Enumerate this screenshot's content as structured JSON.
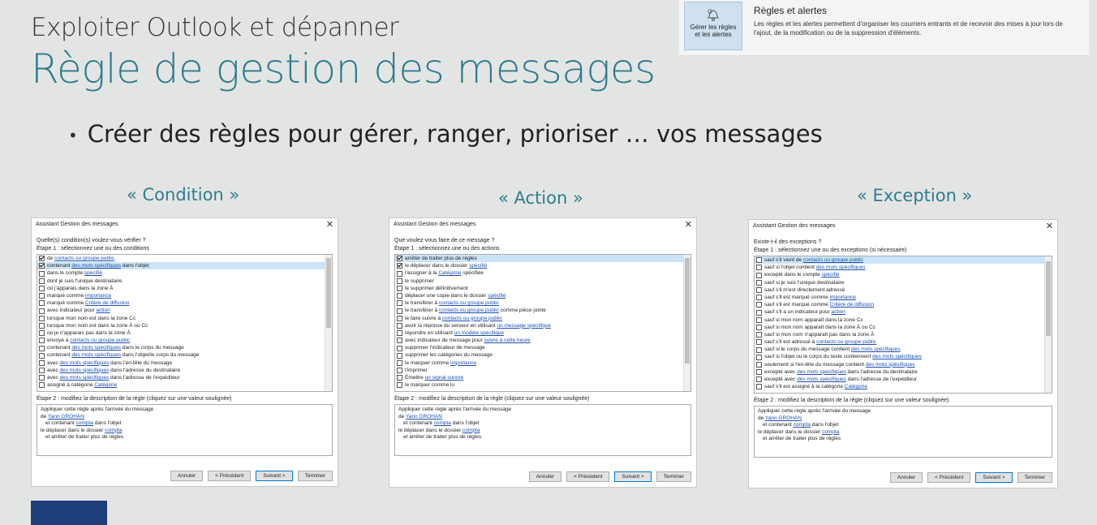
{
  "header": {
    "subtitle": "Exploiter Outlook et dépanner",
    "title": "Règle de gestion des messages",
    "bullet": "Créer des règles pour gérer, ranger, prioriser … vos messages"
  },
  "rules_panel": {
    "button_line1": "Gérer les règles",
    "button_line2": "et les alertes",
    "heading": "Règles et alertes",
    "description": "Les règles et les alertes permettent d'organiser les courriers entrants et de recevoir des mises à jour lors de l'ajout, de la modification ou de la suppression d'éléments."
  },
  "sections": {
    "condition": "« Condition »",
    "action": "« Action »",
    "exception": "« Exception »"
  },
  "dialog_common": {
    "title": "Assistant Gestion des messages",
    "close": "✕",
    "step2": "Étape 2 : modifiez la description de la règle (cliquez sur une valeur soulignée)",
    "buttons": {
      "cancel": "Annuler",
      "prev": "< Précédent",
      "next": "Suivant >",
      "finish": "Terminer"
    }
  },
  "dialogs": [
    {
      "question": "Quelle(s) condition(s) voulez-vous vérifier ?",
      "step1": "Étape 1 : sélectionnez une ou des conditions",
      "items": [
        {
          "checked": true,
          "pre": "de ",
          "link": "contacts ou groupe public",
          "post": ""
        },
        {
          "checked": true,
          "pre": "contenant ",
          "link": "des mots spécifiques",
          "post": " dans l'objet",
          "selected": true
        },
        {
          "checked": false,
          "pre": "dans le compte ",
          "link": "spécifié",
          "post": ""
        },
        {
          "checked": false,
          "pre": "dont je suis l'unique destinataire",
          "link": "",
          "post": ""
        },
        {
          "checked": false,
          "pre": "où j'apparais dans la zone À",
          "link": "",
          "post": ""
        },
        {
          "checked": false,
          "pre": "marqué comme ",
          "link": "importance",
          "post": ""
        },
        {
          "checked": false,
          "pre": "marqué comme ",
          "link": "Critère de diffusion",
          "post": ""
        },
        {
          "checked": false,
          "pre": "avec indicateur pour ",
          "link": "action",
          "post": ""
        },
        {
          "checked": false,
          "pre": "lorsque mon nom est dans la zone Cc",
          "link": "",
          "post": ""
        },
        {
          "checked": false,
          "pre": "lorsque mon nom est dans la zone À ou Cc",
          "link": "",
          "post": ""
        },
        {
          "checked": false,
          "pre": "où je n'apparais pas dans la zone À",
          "link": "",
          "post": ""
        },
        {
          "checked": false,
          "pre": "envoyé à ",
          "link": "contacts ou groupe public",
          "post": ""
        },
        {
          "checked": false,
          "pre": "contenant ",
          "link": "des mots spécifiques",
          "post": " dans le corps du message"
        },
        {
          "checked": false,
          "pre": "contenant ",
          "link": "des mots spécifiques",
          "post": " dans l'objet/le corps du message"
        },
        {
          "checked": false,
          "pre": "avec ",
          "link": "des mots spécifiques",
          "post": " dans l'en-tête du message"
        },
        {
          "checked": false,
          "pre": "avec ",
          "link": "des mots spécifiques",
          "post": " dans l'adresse du destinataire"
        },
        {
          "checked": false,
          "pre": "avec ",
          "link": "des mots spécifiques",
          "post": " dans l'adresse de l'expéditeur"
        },
        {
          "checked": false,
          "pre": "assigné à catégorie ",
          "link": "Catégorie",
          "post": ""
        }
      ]
    },
    {
      "question": "Que voulez-vous faire de ce message ?",
      "step1": "Étape 1 : sélectionnez une ou des actions",
      "items": [
        {
          "checked": true,
          "pre": "arrêter de traiter plus de règles",
          "link": "",
          "post": "",
          "selected": true
        },
        {
          "checked": true,
          "pre": "le déplacer dans le dossier ",
          "link": "spécifié",
          "post": ""
        },
        {
          "checked": false,
          "pre": "l'assigner à la ",
          "link": "Catégorie",
          "post": " spécifiée"
        },
        {
          "checked": false,
          "pre": "le supprimer",
          "link": "",
          "post": ""
        },
        {
          "checked": false,
          "pre": "le supprimer définitivement",
          "link": "",
          "post": ""
        },
        {
          "checked": false,
          "pre": "déplacer une copie dans le dossier ",
          "link": "spécifié",
          "post": ""
        },
        {
          "checked": false,
          "pre": "le transférer à ",
          "link": "contacts ou groupe public",
          "post": ""
        },
        {
          "checked": false,
          "pre": "le transférer à ",
          "link": "contacts ou groupe public",
          "post": " comme pièce jointe"
        },
        {
          "checked": false,
          "pre": "le faire suivre à ",
          "link": "contacts ou groupe public",
          "post": ""
        },
        {
          "checked": false,
          "pre": "avoir la réponse du serveur en utilisant ",
          "link": "un message spécifique",
          "post": ""
        },
        {
          "checked": false,
          "pre": "répondre en utilisant ",
          "link": "un modèle spécifique",
          "post": ""
        },
        {
          "checked": false,
          "pre": "avec indicateur de message pour ",
          "link": "suivre à cette heure",
          "post": ""
        },
        {
          "checked": false,
          "pre": "supprimer l'indicateur de message",
          "link": "",
          "post": ""
        },
        {
          "checked": false,
          "pre": "supprimer les catégories du message",
          "link": "",
          "post": ""
        },
        {
          "checked": false,
          "pre": "le marquer comme ",
          "link": "importance",
          "post": ""
        },
        {
          "checked": false,
          "pre": "l'imprimer",
          "link": "",
          "post": ""
        },
        {
          "checked": false,
          "pre": "Émettre ",
          "link": "un signal sonore",
          "post": ""
        },
        {
          "checked": false,
          "pre": "le marquer comme lu",
          "link": "",
          "post": ""
        }
      ]
    },
    {
      "question": "Existe-t-il des exceptions ?",
      "step1": "Étape 1 : sélectionnez une ou des exceptions (si nécessaire)",
      "items": [
        {
          "checked": false,
          "pre": "sauf s'il vient de ",
          "link": "contacts ou groupe public",
          "post": "",
          "selected": true
        },
        {
          "checked": false,
          "pre": "sauf si l'objet contient ",
          "link": "des mots spécifiques",
          "post": ""
        },
        {
          "checked": false,
          "pre": "excepté dans le compte ",
          "link": "spécifié",
          "post": ""
        },
        {
          "checked": false,
          "pre": "sauf si je suis l'unique destinataire",
          "link": "",
          "post": ""
        },
        {
          "checked": false,
          "pre": "sauf s'il m'est directement adressé",
          "link": "",
          "post": ""
        },
        {
          "checked": false,
          "pre": "sauf s'il est marqué comme ",
          "link": "importance",
          "post": ""
        },
        {
          "checked": false,
          "pre": "sauf s'il est marqué comme ",
          "link": "Critère de diffusion",
          "post": ""
        },
        {
          "checked": false,
          "pre": "sauf s'il a un indicateur pour ",
          "link": "action",
          "post": ""
        },
        {
          "checked": false,
          "pre": "sauf si mon nom apparaît dans la zone Cc",
          "link": "",
          "post": ""
        },
        {
          "checked": false,
          "pre": "sauf si mon nom apparaît dans la zone À ou Cc",
          "link": "",
          "post": ""
        },
        {
          "checked": false,
          "pre": "sauf si mon nom n'apparaît pas dans la zone À",
          "link": "",
          "post": ""
        },
        {
          "checked": false,
          "pre": "sauf s'il est adressé à ",
          "link": "contacts ou groupe public",
          "post": ""
        },
        {
          "checked": false,
          "pre": "sauf si le corps du message contient ",
          "link": "des mots spécifiques",
          "post": ""
        },
        {
          "checked": false,
          "pre": "sauf si l'objet ou le corps du texte contiennent ",
          "link": "des mots spécifiques",
          "post": ""
        },
        {
          "checked": false,
          "pre": "seulement si l'en-tête du message contient ",
          "link": "des mots spécifiques",
          "post": ""
        },
        {
          "checked": false,
          "pre": "excepté avec ",
          "link": "des mots spécifiques",
          "post": " dans l'adresse du destinataire"
        },
        {
          "checked": false,
          "pre": "excepté avec ",
          "link": "des mots spécifiques",
          "post": " dans l'adresse de l'expéditeur"
        },
        {
          "checked": false,
          "pre": "sauf s'il est assigné à la catégorie ",
          "link": "Catégorie",
          "post": ""
        }
      ]
    }
  ],
  "rule_description": {
    "line1": "Appliquer cette règle après l'arrivée du message",
    "line2_pre": "de ",
    "line2_link": "Yann GROHAN",
    "line3_pre": "  et contenant ",
    "line3_link": "compta",
    "line3_post": " dans l'objet",
    "line4_pre": "le déplacer dans le dossier ",
    "line4_link": "compta",
    "line5": "  et arrêter de traiter plus de règles"
  }
}
